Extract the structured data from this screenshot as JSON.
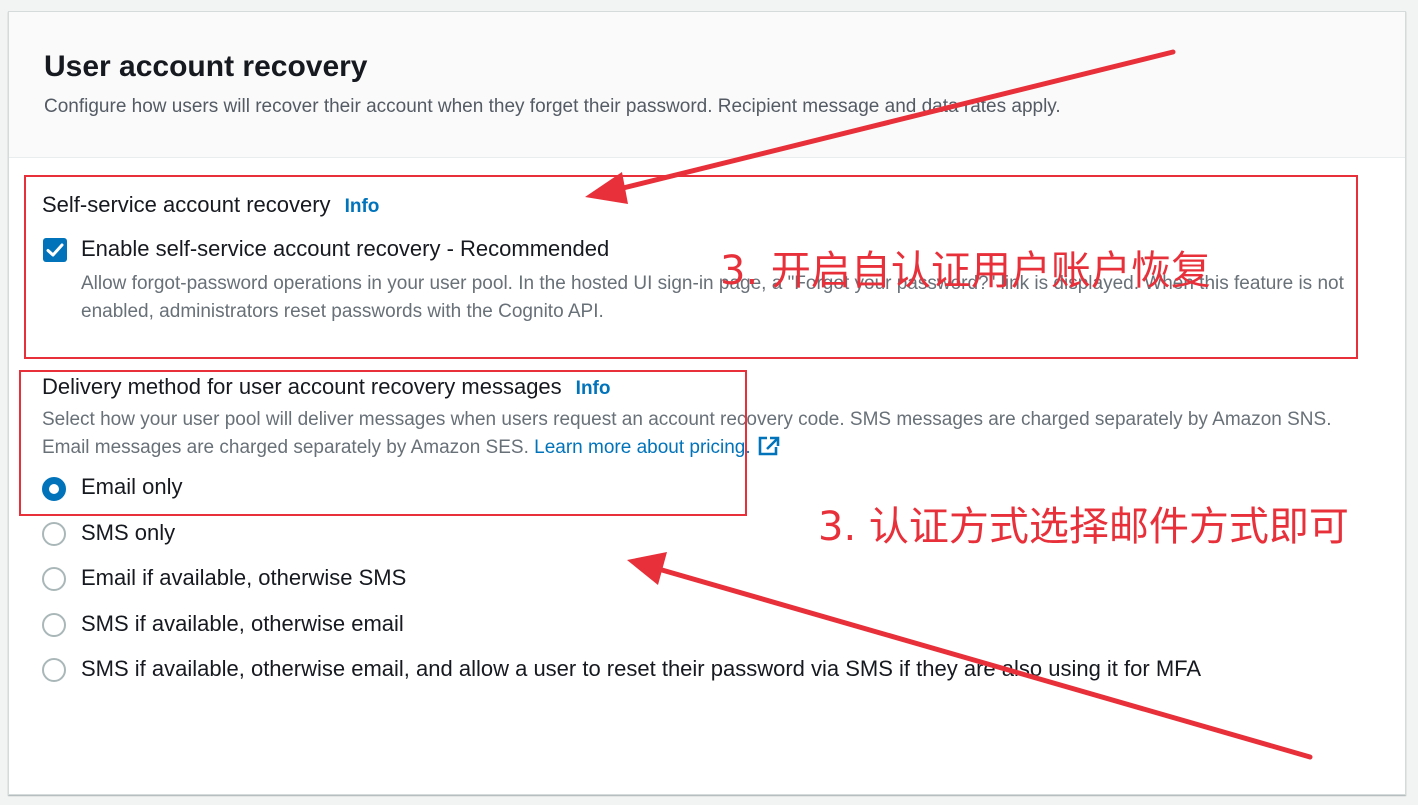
{
  "section": {
    "title": "User account recovery",
    "description": "Configure how users will recover their account when they forget their password. Recipient message and data rates apply."
  },
  "self_service": {
    "label": "Self-service account recovery",
    "info": "Info",
    "checkbox_label": "Enable self-service account recovery - Recommended",
    "checkbox_checked": true,
    "description": "Allow forgot-password operations in your user pool. In the hosted UI sign-in page, a \"Forgot your password?\" link is displayed. When this feature is not enabled, administrators reset passwords with the Cognito API."
  },
  "delivery": {
    "label": "Delivery method for user account recovery messages",
    "info": "Info",
    "description": "Select how your user pool will deliver messages when users request an account recovery code. SMS messages are charged separately by Amazon SNS. Email messages are charged separately by Amazon SES.",
    "learn_more": "Learn more about pricing.",
    "options": [
      {
        "label": "Email only",
        "selected": true
      },
      {
        "label": "SMS only",
        "selected": false
      },
      {
        "label": "Email if available, otherwise SMS",
        "selected": false
      },
      {
        "label": "SMS if available, otherwise email",
        "selected": false
      },
      {
        "label": "SMS if available, otherwise email, and allow a user to reset their password via SMS if they are also using it for MFA",
        "selected": false
      }
    ]
  },
  "annotations": {
    "note_1": "3. 开启自认证用户账户恢复",
    "note_2": "3. 认证方式选择邮件方式即可",
    "color": "#e8303a"
  },
  "icons": {
    "checkbox": "checkmark-icon",
    "external_link": "external-link-icon"
  },
  "colors": {
    "accent": "#0073bb",
    "heading": "#16191f",
    "secondary_text": "#687078"
  }
}
